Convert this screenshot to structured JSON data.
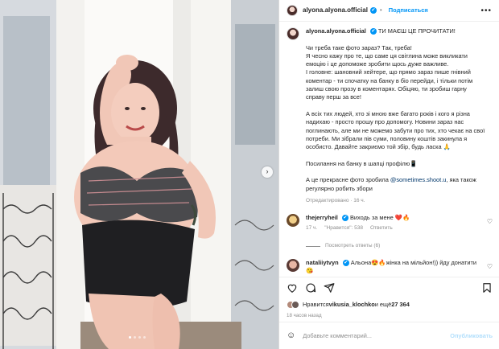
{
  "header": {
    "username": "alyona.alyona.official",
    "verified_mark": "✔",
    "follow_label": "Подписаться",
    "more_label": "•••"
  },
  "caption": {
    "username": "alyona.alyona.official",
    "headline": "ТИ МАЄШ ЦЕ ПРОЧИТАТИ!",
    "para1": [
      "Чи треба таке фото зараз? Так, треба!",
      "Я чесно кажу про те, що саме ця світлина може викликати",
      "емоцію і це допоможе зробити щось дуже важливе.",
      "І головне: шановний хейтере, що прямо зараз пише гнівний",
      "коментар - ти спочатку на банку в біо перейди, і тільки потім",
      "залиш свою прозу в коментарях. Обіцяю, ти зробиш гарну",
      "справу перш за все!"
    ],
    "para2": [
      "А всіх тих людей, хто зі мною вже багато років і кого я різна",
      "надихаю - просто прошу про допомогу. Новини зараз нас",
      "поглинають, але ми не можемо забути про тих, хто чекає на свої",
      "потреби. Ми зібрали пів суми, половину коштів закинула я",
      "особисто. Давайте закриємо той збір, будь ласка 🙏"
    ],
    "para3": "Посилання на банку в шапці профілю📱",
    "para4_before": "А це прекрасне фото зробила ",
    "para4_link": "@sometimes.shoot.u",
    "para4_after": ", яка також",
    "para4_line2": "регулярно робить збори",
    "edited": "Отредактировано · 16 ч."
  },
  "comments": [
    {
      "username": "thejerryheil",
      "text": "Виходь за мене ❤️🔥",
      "time": "17 ч.",
      "likes": "\"Нравится\": 538",
      "reply": "Ответить",
      "avatar_color": "#d9a441"
    },
    {
      "username": "nataliiytvyn",
      "text": "Альона😍🔥жінка на мільйон!)) йду донатити",
      "text_line2": "😘",
      "avatar_color": "#b57062"
    }
  ],
  "replies_label": "Посмотреть ответы (6)",
  "likes": {
    "prefix": "Нравится ",
    "user": "vikusia_klochko",
    "middle": " и ещё ",
    "count": "27 364"
  },
  "timestamp": "18 часов назад",
  "add_comment": {
    "placeholder": "Добавьте комментарий...",
    "publish_label": "Опубликовать"
  },
  "colors": {
    "accent": "#0095f6",
    "heart": "#ed4956"
  },
  "icons": [
    "heart-icon",
    "comment-icon",
    "share-icon",
    "bookmark-icon",
    "emoji-icon",
    "chevron-right-icon",
    "verified-icon"
  ]
}
